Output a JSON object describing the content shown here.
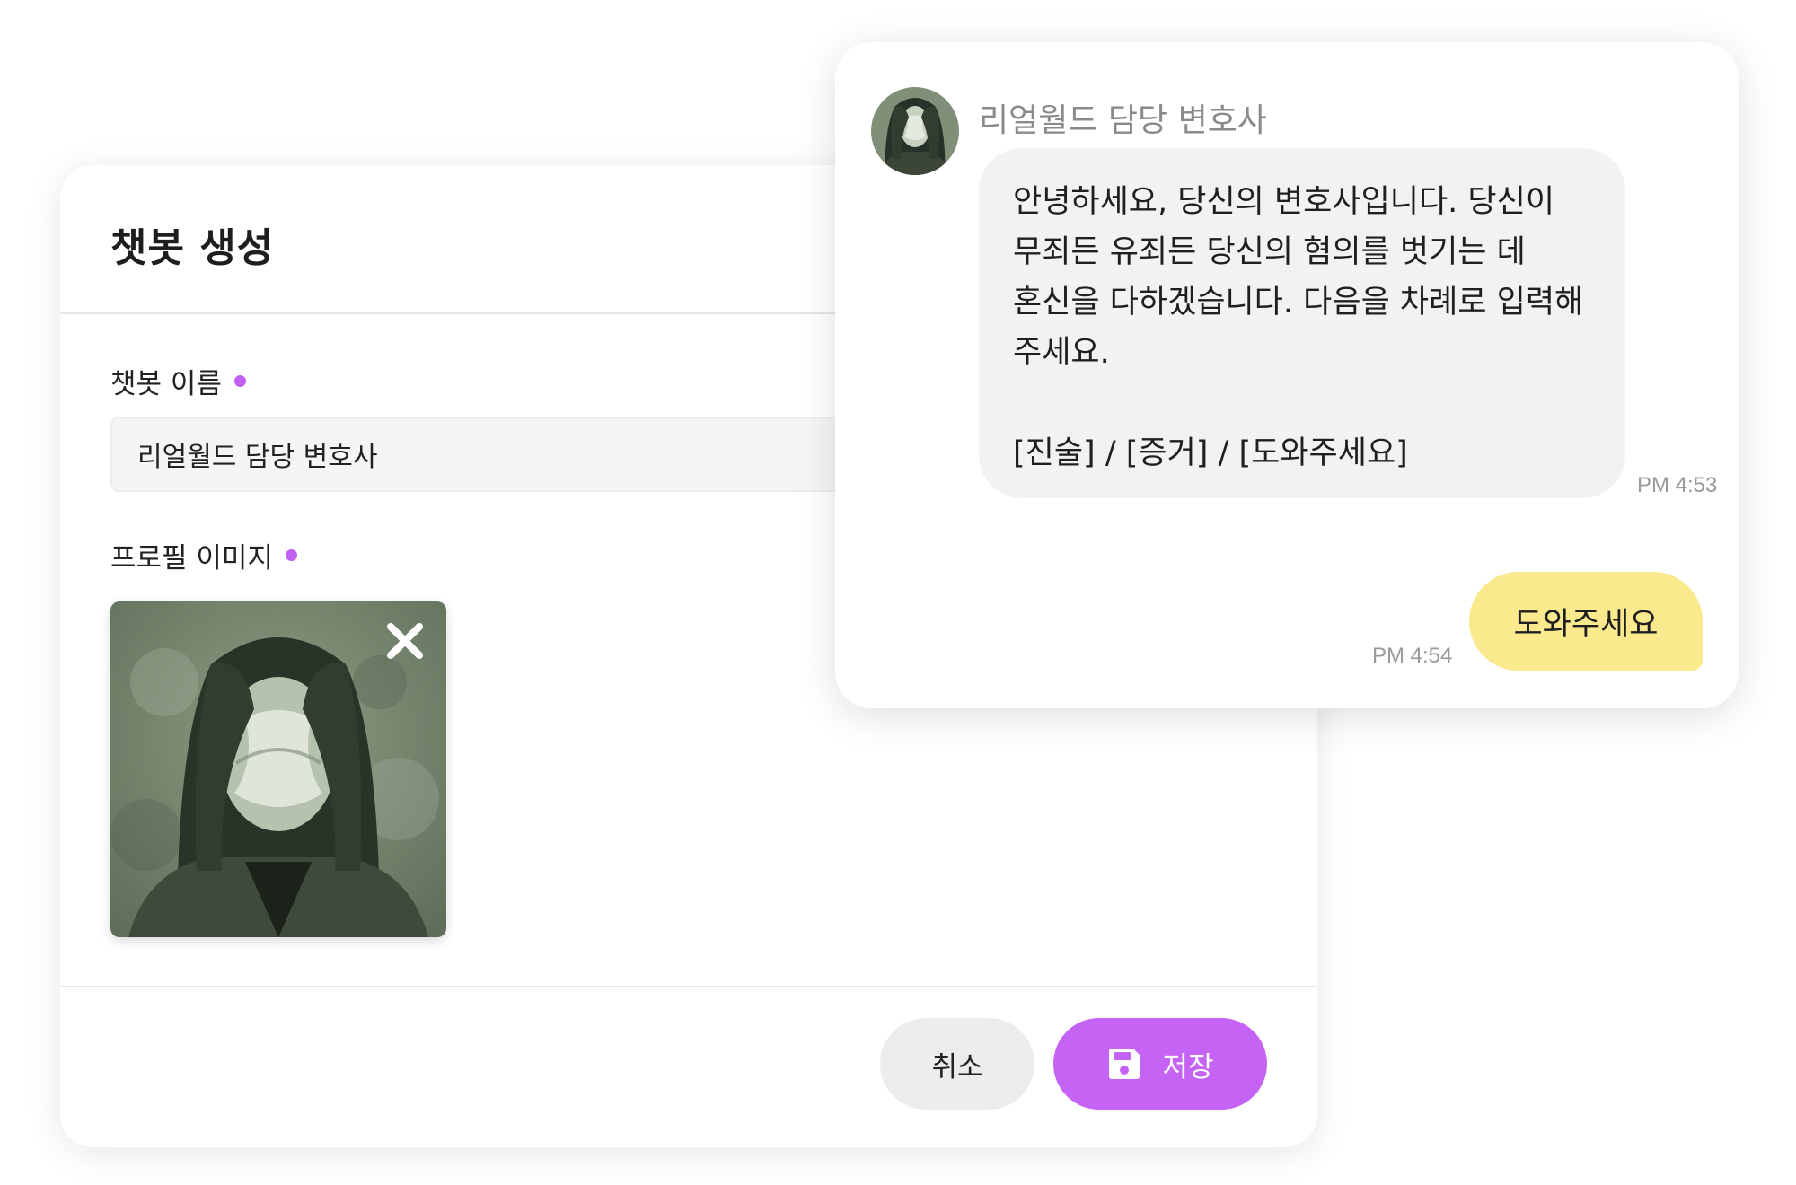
{
  "create_form": {
    "title": "챗봇 생성",
    "name_label": "챗봇 이름",
    "name_value": "리얼월드 담당 변호사",
    "image_label": "프로필 이미지",
    "cancel_label": "취소",
    "save_label": "저장"
  },
  "chat": {
    "bot_name": "리얼월드 담당 변호사",
    "messages": [
      {
        "sender": "bot",
        "text": "안녕하세요, 당신의 변호사입니다. 당신이 무죄든 유죄든 당신의 혐의를 벗기는 데 혼신을 다하겠습니다. 다음을 차례로 입력해 주세요.\n\n[진술] / [증거] / [도와주세요]",
        "time": "PM 4:53"
      },
      {
        "sender": "user",
        "text": "도와주세요",
        "time": "PM 4:54"
      }
    ]
  },
  "icons": {
    "remove": "close-icon",
    "save": "floppy-disk-icon"
  },
  "colors": {
    "accent": "#c563f4",
    "required_dot": "#c05ff0",
    "user_bubble": "#fbe98e",
    "bot_bubble": "#f2f2f2"
  }
}
